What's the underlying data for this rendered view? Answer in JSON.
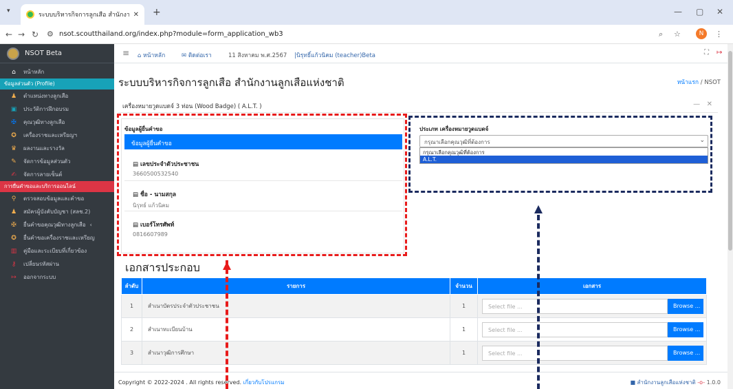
{
  "browser": {
    "tab_title": "ระบบบริหารกิจการลูกเสือ สำนักงานลูกเสือแห่งชาติ",
    "url": "nsot.scoutthailand.org/index.php?module=form_application_wb3",
    "profile_initial": "N"
  },
  "sidebar": {
    "brand": "NSOT Beta",
    "home": "หน้าหลัก",
    "section_profile": "ข้อมูลส่วนตัว (Profile)",
    "items_profile": [
      {
        "label": "ตำแหน่งทางลูกเสือ",
        "icon": "users-icon",
        "color": "#f0ad4e"
      },
      {
        "label": "ประวัติการฝึกอบรม",
        "icon": "id-card-icon",
        "color": "#17a2b8"
      },
      {
        "label": "คุณวุฒิทางลูกเสือ",
        "icon": "badge-icon",
        "color": "#007bff"
      },
      {
        "label": "เครื่องราชและเหรียญฯ",
        "icon": "medal-icon",
        "color": "#f0ad4e"
      },
      {
        "label": "ผลงานและรางวัล",
        "icon": "trophy-icon",
        "color": "#f0ad4e"
      },
      {
        "label": "จัดการข้อมูลส่วนตัว",
        "icon": "user-edit-icon",
        "color": "#f0ad4e"
      },
      {
        "label": "จัดการลายเซ็นต์",
        "icon": "signature-icon",
        "color": "#dc3545"
      }
    ],
    "section_services": "การยื่นคำขอและบริการออนไลน์",
    "items_services": [
      {
        "label": "ตรวจสอบข้อมูลและคำขอ",
        "icon": "search-icon",
        "color": "#f0ad4e"
      },
      {
        "label": "สมัครผู้บังคับบัญชา (สลช.2)",
        "icon": "user-plus-icon",
        "color": "#f0ad4e"
      },
      {
        "label": "ยื่นคำขอคุณวุฒิทางลูกเสือ",
        "icon": "badge-icon",
        "color": "#f0ad4e",
        "chevron": "‹"
      },
      {
        "label": "ยื่นคำขอเครื่องราชและเหรียญ",
        "icon": "medal-icon",
        "color": "#f0ad4e"
      },
      {
        "label": "คู่มือและระเบียบที่เกี่ยวข้อง",
        "icon": "book-icon",
        "color": "#dc3545"
      },
      {
        "label": "เปลี่ยนรหัสผ่าน",
        "icon": "key-icon",
        "color": "#dc3545"
      },
      {
        "label": "ออกจากระบบ",
        "icon": "logout-icon",
        "color": "#dc3545"
      }
    ]
  },
  "topnav": {
    "home": "หน้าหลัก",
    "contact": "ติดต่อเรา",
    "date": "11 สิงหาคม พ.ศ.2567",
    "user": "|นิรุทธิ์แก้วนิคม (teacher)Beta"
  },
  "page": {
    "title": "ระบบบริหารกิจการลูกเสือ สำนักงานลูกเสือแห่งชาติ",
    "breadcrumb_home": "หน้าแรก",
    "breadcrumb_current": "/ NSOT",
    "card_title": "เครื่องหมายวูดแบดจ์ 3 ท่อน (Wood Badge) ( A.L.T. )"
  },
  "applicant": {
    "header": "ข้อมูลผู้ยื่นคำขอ",
    "active_label": "ข้อมูลผู้ยื่นคำขอ",
    "fields": [
      {
        "label": "เลขประจำตัวประชาชน",
        "value": "3660500532540"
      },
      {
        "label": "ชื่อ - นามสกุล",
        "value": "นิรุทธ์ แก้วนิคม"
      },
      {
        "label": "เบอร์โทรศัพท์",
        "value": "0816607989"
      }
    ]
  },
  "badge_type": {
    "label": "ประเภท เครื่องหมายวูดแบดจ์",
    "selected": "กรุณาเลือกคุณวุฒิที่ต้องการ",
    "options": [
      "กรุณาเลือกคุณวุฒิที่ต้องการ",
      "A.L.T."
    ]
  },
  "documents": {
    "title": "เอกสารประกอบ",
    "headers": [
      "ลำดับ",
      "รายการ",
      "จำนวน",
      "เอกสาร"
    ],
    "rows": [
      {
        "no": "1",
        "item": "สำเนาบัตรประจำตัวประชาชน",
        "qty": "1",
        "placeholder": "Select file ...",
        "button": "Browse ..."
      },
      {
        "no": "2",
        "item": "สำเนาทะเบียนบ้าน",
        "qty": "1",
        "placeholder": "Select file ...",
        "button": "Browse ..."
      },
      {
        "no": "3",
        "item": "สำเนาวุฒิการศึกษา",
        "qty": "1",
        "placeholder": "Select file ...",
        "button": "Browse ..."
      }
    ]
  },
  "footer": {
    "copyright": "Copyright © 2022-2024 . All rights reserved.",
    "about_link": "เกี่ยวกับโปรแกรม",
    "org": "สำนักงานลูกเสือแห่งชาติ",
    "version": "1.0.0"
  },
  "annotation_colors": {
    "red": "#e81b1b",
    "navy": "#1b2b5f"
  }
}
